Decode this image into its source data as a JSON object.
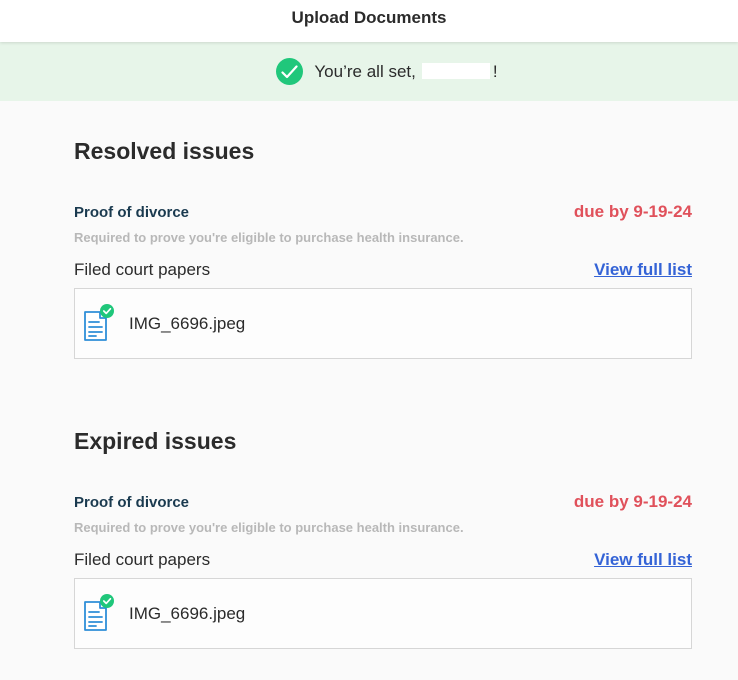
{
  "header": {
    "title": "Upload Documents"
  },
  "banner": {
    "message_prefix": "You’re all set,",
    "message_suffix": "!"
  },
  "sections": [
    {
      "title": "Resolved issues",
      "issue": {
        "name": "Proof of divorce",
        "due": "due by 9-19-24",
        "description": "Required to prove you're eligible to purchase health insurance.",
        "document_type": "Filed court papers",
        "view_link": "View full list",
        "file_name": "IMG_6696.jpeg"
      }
    },
    {
      "title": "Expired issues",
      "issue": {
        "name": "Proof of divorce",
        "due": "due by 9-19-24",
        "description": "Required to prove you're eligible to purchase health insurance.",
        "document_type": "Filed court papers",
        "view_link": "View full list",
        "file_name": "IMG_6696.jpeg"
      }
    }
  ],
  "colors": {
    "success": "#20c77b",
    "due": "#e0515b",
    "link": "#3463d6",
    "banner_bg": "#e7f5e9",
    "issue_name": "#1a3a4f",
    "file_icon": "#2f8fd8"
  },
  "icons": {
    "banner": "check-circle-icon",
    "file": "document-checked-icon"
  }
}
